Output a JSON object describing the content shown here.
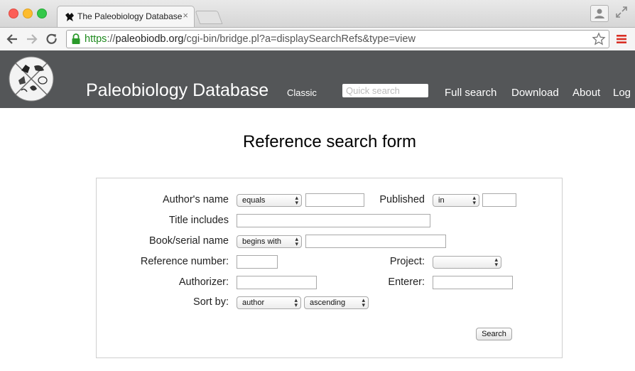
{
  "browser": {
    "tab_title": "The Paleobiology Database",
    "tab_close": "×",
    "url_scheme": "https",
    "url_sep": "://",
    "url_host": "paleobiodb.org",
    "url_path": "/cgi-bin/bridge.pl?a=displaySearchRefs&type=view"
  },
  "site": {
    "title": "Paleobiology Database",
    "nav": {
      "classic": "Classic",
      "quick_search_placeholder": "Quick search",
      "full_search": "Full search",
      "download": "Download",
      "about": "About",
      "log": "Log"
    }
  },
  "page": {
    "heading": "Reference search form"
  },
  "form": {
    "author_label": "Author's name",
    "author_match": "equals",
    "published_label": "Published",
    "published_match": "in",
    "title_label": "Title includes",
    "book_label": "Book/serial name",
    "book_match": "begins with",
    "refnum_label": "Reference number:",
    "project_label": "Project:",
    "project_value": "",
    "authorizer_label": "Authorizer:",
    "enterer_label": "Enterer:",
    "sort_label": "Sort by:",
    "sort_field": "author",
    "sort_order": "ascending",
    "search_button": "Search",
    "author_value": "",
    "published_value": "",
    "title_value": "",
    "book_value": "",
    "refnum_value": "",
    "authorizer_value": "",
    "enterer_value": ""
  },
  "colors": {
    "header_bg": "#545658",
    "secure_green": "#1e8a1e",
    "menu_red": "#d93025"
  }
}
